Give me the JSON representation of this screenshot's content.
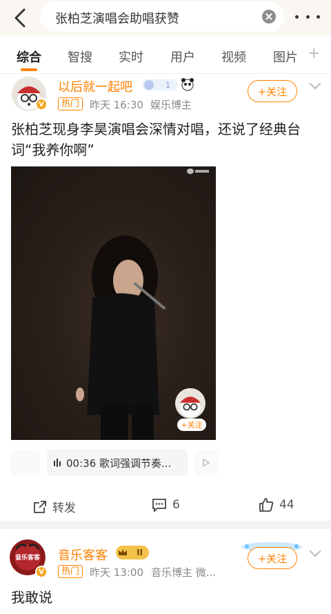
{
  "search": {
    "query": "张柏芝演唱会助唱获赞"
  },
  "tabs": [
    {
      "label": "综合"
    },
    {
      "label": "智搜"
    },
    {
      "label": "实时"
    },
    {
      "label": "用户"
    },
    {
      "label": "视频"
    },
    {
      "label": "图片"
    }
  ],
  "post1": {
    "author": "以后就一起吧",
    "hot_tag": "热门",
    "time": "昨天 16:30",
    "role": "娱乐博主",
    "follow_label": "+关注",
    "text": "张柏芝现身李昊演唱会深情对唱，还说了经典台词“我养你啊”",
    "video": {
      "follow_small": "+关注"
    },
    "audio": {
      "time": "00:36",
      "label": "歌词强调节奏..."
    },
    "actions": {
      "repost": "转发",
      "comments": "6",
      "likes": "44"
    }
  },
  "post2": {
    "author": "音乐客客",
    "level": "II",
    "avatar_text": "音乐客客",
    "hot_tag": "热门",
    "time": "昨天 13:00",
    "role": "音乐博主 微...",
    "follow_label": "+关注",
    "text": "我敢说"
  },
  "colors": {
    "accent": "#ff8200"
  }
}
